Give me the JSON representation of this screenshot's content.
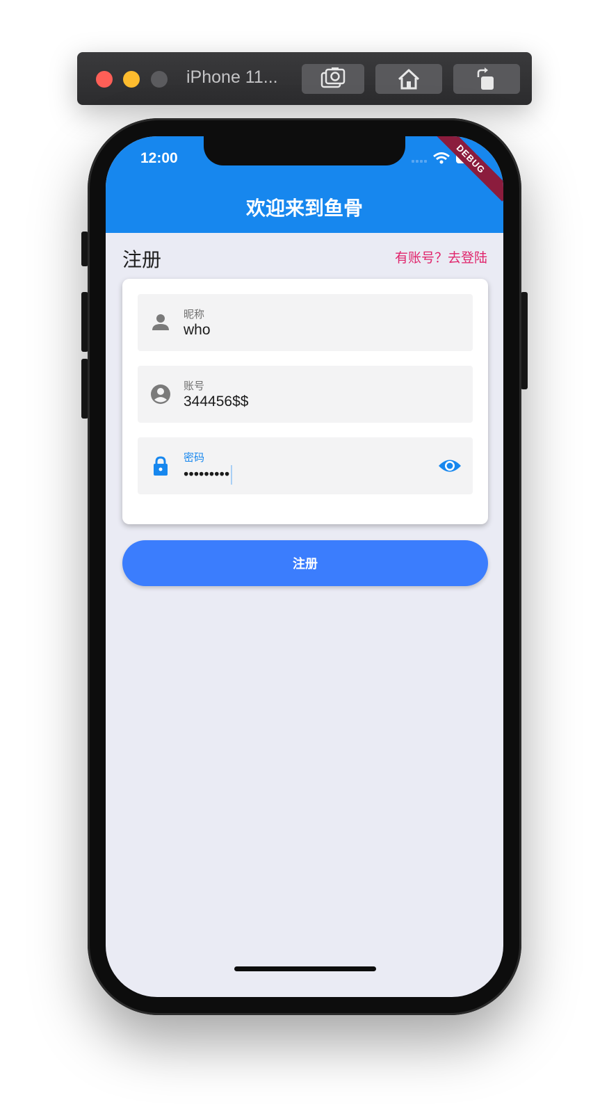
{
  "simulator": {
    "device_name": "iPhone 11...",
    "screenshot_icon": "camera-icon",
    "home_icon": "home-icon",
    "rotate_icon": "rotate-icon"
  },
  "status_bar": {
    "time": "12:00",
    "signal_icon": "signal-icon",
    "wifi_icon": "wifi-icon",
    "battery_icon": "battery-icon"
  },
  "app_bar": {
    "title": "欢迎来到鱼骨",
    "debug_banner": "DEBUG"
  },
  "page": {
    "section_title": "注册",
    "login_link": "有账号？去登陆"
  },
  "form": {
    "nickname": {
      "label": "昵称",
      "value": "who",
      "icon": "person-icon"
    },
    "account": {
      "label": "账号",
      "value": "344456$$",
      "icon": "account-circle-icon"
    },
    "password": {
      "label": "密码",
      "value": "•••••••••",
      "icon": "lock-icon",
      "toggle_icon": "eye-icon"
    },
    "submit_label": "注册"
  },
  "colors": {
    "app_bar": "#1787ee",
    "background": "#eaebf4",
    "link": "#e0246b",
    "button": "#3b7dfd",
    "focus": "#1787ee"
  }
}
